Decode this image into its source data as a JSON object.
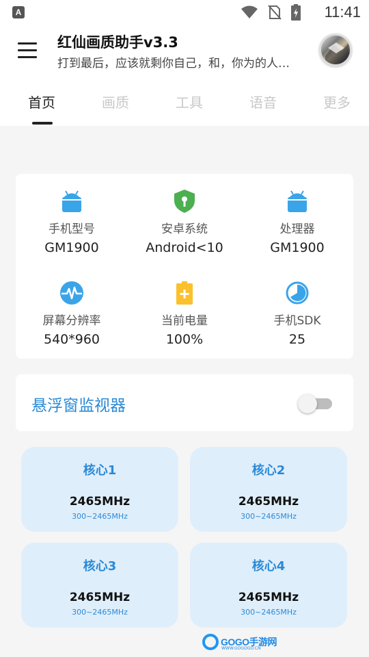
{
  "status_bar": {
    "badge": "A",
    "time": "11:41",
    "icons": [
      "wifi-icon",
      "no-sim-icon",
      "battery-charging-icon"
    ]
  },
  "app_bar": {
    "title": "红仙画质助手v3.3",
    "subtitle": "打到最后，应该就剩你自己，和，你为的人…",
    "menu_icon": "hamburger-menu-icon",
    "avatar_icon": "user-avatar"
  },
  "tabs": [
    {
      "label": "首页",
      "active": true
    },
    {
      "label": "画质",
      "active": false
    },
    {
      "label": "工具",
      "active": false
    },
    {
      "label": "语音",
      "active": false
    },
    {
      "label": "更多",
      "active": false
    }
  ],
  "device_info": [
    {
      "icon": "android-icon",
      "label": "手机型号",
      "value": "GM1900"
    },
    {
      "icon": "shield-icon",
      "label": "安卓系统",
      "value": "Android<10"
    },
    {
      "icon": "android-icon",
      "label": "处理器",
      "value": "GM1900"
    },
    {
      "icon": "pulse-icon",
      "label": "屏幕分辨率",
      "value": "540*960"
    },
    {
      "icon": "battery-icon",
      "label": "当前电量",
      "value": "100%"
    },
    {
      "icon": "sdk-icon",
      "label": "手机SDK",
      "value": "25"
    }
  ],
  "monitor": {
    "label": "悬浮窗监视器",
    "enabled": false
  },
  "cores": [
    {
      "title": "核心1",
      "freq": "2465MHz",
      "range": "300~2465MHz"
    },
    {
      "title": "核心2",
      "freq": "2465MHz",
      "range": "300~2465MHz"
    },
    {
      "title": "核心3",
      "freq": "2465MHz",
      "range": "300~2465MHz"
    },
    {
      "title": "核心4",
      "freq": "2465MHz",
      "range": "300~2465MHz"
    }
  ],
  "watermark": {
    "brand": "GOGO手游网",
    "url": "WWW.GOGOGO.CN"
  },
  "colors": {
    "accent": "#2a8ad6",
    "card_blue": "#dfeefb",
    "android_blue": "#3aa4e8",
    "shield_green": "#4caf50",
    "battery_yellow": "#fbc02d"
  }
}
